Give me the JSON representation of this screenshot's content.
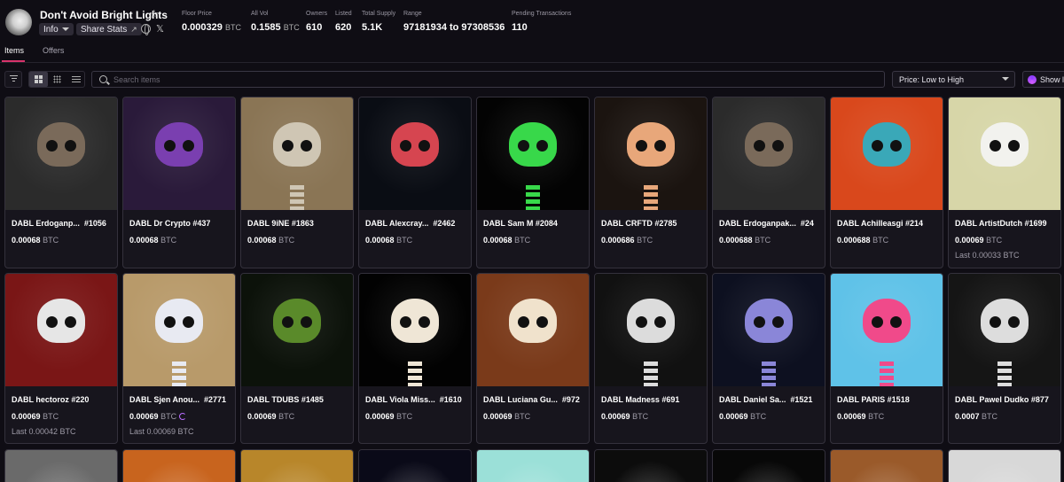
{
  "collection": {
    "title": "Don't Avoid Bright Lights",
    "info_label": "Info",
    "share_label": "Share Stats"
  },
  "stats": [
    {
      "label": "Floor Price",
      "value": "0.000329",
      "unit": "BTC"
    },
    {
      "label": "All Vol",
      "value": "0.1585",
      "unit": "BTC"
    },
    {
      "label": "Owners",
      "value": "610",
      "unit": ""
    },
    {
      "label": "Listed",
      "value": "620",
      "unit": ""
    },
    {
      "label": "Total Supply",
      "value": "5.1K",
      "unit": ""
    },
    {
      "label": "Range",
      "value": "97181934 to 97308536",
      "unit": ""
    },
    {
      "label": "Pending Transactions",
      "value": "110",
      "unit": ""
    }
  ],
  "tabs": [
    {
      "label": "Items",
      "active": true
    },
    {
      "label": "Offers",
      "active": false
    }
  ],
  "toolbar": {
    "search_placeholder": "Search items",
    "sort_label": "Price: Low to High",
    "show_label": "Show l"
  },
  "cards": [
    {
      "name": "DABL Erdoganp...",
      "number": "#1056",
      "price": "0.00068",
      "unit": "BTC",
      "last": "",
      "bg": "#2b2b2b",
      "skull": "#7a6a5a"
    },
    {
      "name": "DABL Dr Crypto #437",
      "number": "",
      "price": "0.00068",
      "unit": "BTC",
      "last": "",
      "bg": "#2a1a3a",
      "skull": "#7a3fb0"
    },
    {
      "name": "DABL 9iNE #1863",
      "number": "",
      "price": "0.00068",
      "unit": "BTC",
      "last": "",
      "bg": "#8a7555",
      "skull": "#cfc6b4"
    },
    {
      "name": "DABL Alexcray...",
      "number": "#2462",
      "price": "0.00068",
      "unit": "BTC",
      "last": "",
      "bg": "#0a0d14",
      "skull": "#d64550"
    },
    {
      "name": "DABL Sam M #2084",
      "number": "",
      "price": "0.00068",
      "unit": "BTC",
      "last": "",
      "bg": "#030303",
      "skull": "#38d84a"
    },
    {
      "name": "DABL CRFTD #2785",
      "number": "",
      "price": "0.000686",
      "unit": "BTC",
      "last": "",
      "bg": "#1b1410",
      "skull": "#e8a77a"
    },
    {
      "name": "DABL Erdoganpak...",
      "number": "#24",
      "price": "0.000688",
      "unit": "BTC",
      "last": "",
      "bg": "#2b2b2b",
      "skull": "#7a6a5a"
    },
    {
      "name": "DABL Achilleasgi #214",
      "number": "",
      "price": "0.000688",
      "unit": "BTC",
      "last": "",
      "bg": "#d9481c",
      "skull": "#3aa8b8"
    },
    {
      "name": "DABL ArtistDutch #1699",
      "number": "",
      "price": "0.00069",
      "unit": "BTC",
      "last": "Last 0.00033 BTC",
      "bg": "#d7d6a8",
      "skull": "#f2f2ee"
    },
    {
      "name": "DABL hectoroz #220",
      "number": "",
      "price": "0.00069",
      "unit": "BTC",
      "last": "Last 0.00042 BTC",
      "bg": "#7a1616",
      "skull": "#e6e6e6"
    },
    {
      "name": "DABL Sjen Anou...",
      "number": "#2771",
      "price": "0.00069",
      "unit": "BTC",
      "last": "Last 0.00069 BTC",
      "bg": "#b89a6a",
      "skull": "#e8eaf2"
    },
    {
      "name": "DABL TDUBS #1485",
      "number": "",
      "price": "0.00069",
      "unit": "BTC",
      "last": "",
      "bg": "#0c120a",
      "skull": "#5a8a2a"
    },
    {
      "name": "DABL Viola Miss...",
      "number": "#1610",
      "price": "0.00069",
      "unit": "BTC",
      "last": "",
      "bg": "#020202",
      "skull": "#efe6d6"
    },
    {
      "name": "DABL Luciana Gu...",
      "number": "#972",
      "price": "0.00069",
      "unit": "BTC",
      "last": "",
      "bg": "#7a3a1a",
      "skull": "#f0e2cc"
    },
    {
      "name": "DABL Madness #691",
      "number": "",
      "price": "0.00069",
      "unit": "BTC",
      "last": "",
      "bg": "#111111",
      "skull": "#dcdcdc"
    },
    {
      "name": "DABL Daniel Sa...",
      "number": "#1521",
      "price": "0.00069",
      "unit": "BTC",
      "last": "",
      "bg": "#0d1020",
      "skull": "#8a86d8"
    },
    {
      "name": "DABL PARIS #1518",
      "number": "",
      "price": "0.00069",
      "unit": "BTC",
      "last": "",
      "bg": "#5fc2e8",
      "skull": "#f04a8a"
    },
    {
      "name": "DABL Pawel Dudko #877",
      "number": "",
      "price": "0.0007",
      "unit": "BTC",
      "last": "",
      "bg": "#151515",
      "skull": "#dddddd"
    }
  ],
  "bottom_row": [
    {
      "bg": "#6a6a6a"
    },
    {
      "bg": "#c8641e"
    },
    {
      "bg": "#b8862a"
    },
    {
      "bg": "#0a0a18"
    },
    {
      "bg": "#9be0d8"
    },
    {
      "bg": "#0c0c0c"
    },
    {
      "bg": "#080808"
    },
    {
      "bg": "#9a5a2a"
    },
    {
      "bg": "#d8d8d8"
    }
  ]
}
